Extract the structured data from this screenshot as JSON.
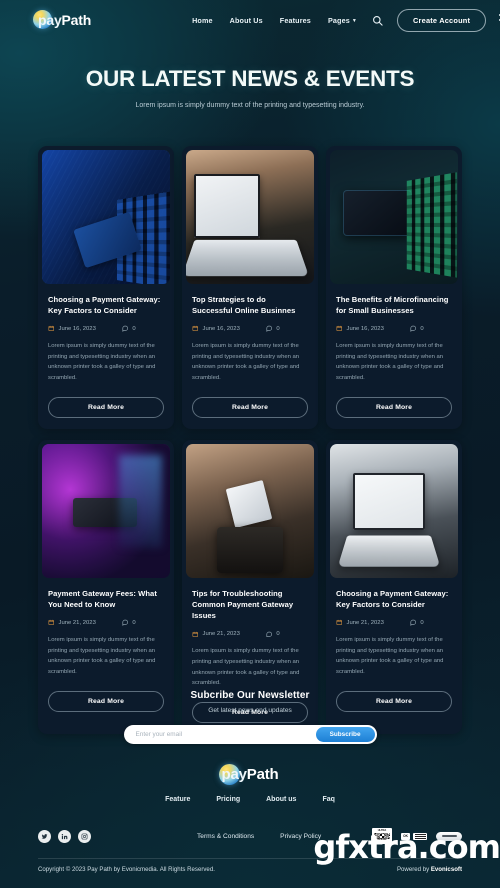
{
  "brand": {
    "name_part1": "pay",
    "name_part2": "Path"
  },
  "header": {
    "nav": [
      {
        "label": "Home",
        "has_caret": false
      },
      {
        "label": "About Us",
        "has_caret": false
      },
      {
        "label": "Features",
        "has_caret": false
      },
      {
        "label": "Pages",
        "has_caret": true
      }
    ],
    "search_icon": "search-icon",
    "cta_label": "Create Account",
    "menu_icon": "hamburger-menu-icon"
  },
  "hero": {
    "title": "OUR LATEST NEWS & EVENTS",
    "subtitle": "Lorem ipsum is simply dummy text of the printing and typesetting industry."
  },
  "posts": [
    {
      "title": "Choosing a Payment Gateway: Key Factors to Consider",
      "date": "June 16, 2023",
      "comments": "0",
      "excerpt": "Lorem ipsum is simply dummy text of the printing and typesetting industry when an unknown printer took a galley of type and scrambled.",
      "button": "Read More",
      "image": "payment-card-on-laptop-keyboard-blue"
    },
    {
      "title": "Top Strategies to do Successful Online Businnes",
      "date": "June 16, 2023",
      "comments": "0",
      "excerpt": "Lorem ipsum is simply dummy text of the printing and typesetting industry when an unknown printer took a galley of type and scrambled.",
      "button": "Read More",
      "image": "laptop-and-phone-with-stock-charts-on-desk"
    },
    {
      "title": "The Benefits of Microfinancing for Small Businesses",
      "date": "June 16, 2023",
      "comments": "0",
      "excerpt": "Lorem ipsum is simply dummy text of the printing and typesetting industry when an unknown printer took a galley of type and scrambled.",
      "button": "Read More",
      "image": "credit-card-beside-green-lit-keyboard"
    },
    {
      "title": "Payment Gateway Fees: What You Need to Know",
      "date": "June 21, 2023",
      "comments": "0",
      "excerpt": "Lorem ipsum is simply dummy text of the printing and typesetting industry when an unknown printer took a galley of type and scrambled.",
      "button": "Read More",
      "image": "hands-holding-card-reader-purple-light"
    },
    {
      "title": "Tips for Troubleshooting Common Payment Gateway Issues",
      "date": "June 21, 2023",
      "comments": "0",
      "excerpt": "Lorem ipsum is simply dummy text of the printing and typesetting industry when an unknown printer took a galley of type and scrambled.",
      "button": "Read More",
      "image": "hand-tapping-card-on-payment-terminal"
    },
    {
      "title": "Choosing a Payment Gateway: Key Factors to Consider",
      "date": "June 21, 2023",
      "comments": "0",
      "excerpt": "Lorem ipsum is simply dummy text of the printing and typesetting industry when an unknown printer took a galley of type and scrambled.",
      "button": "Read More",
      "image": "person-using-laptop-with-chart-on-screen"
    }
  ],
  "newsletter": {
    "title": "Subcribe Our Newsletter",
    "subtitle": "Get latest news and updates",
    "placeholder": "Enter your email",
    "input_value": "",
    "button": "Subscribe"
  },
  "footer": {
    "nav": [
      {
        "label": "Feature"
      },
      {
        "label": "Pricing"
      },
      {
        "label": "About us"
      },
      {
        "label": "Faq"
      }
    ],
    "socials": [
      {
        "name": "twitter-icon"
      },
      {
        "name": "linkedin-icon"
      },
      {
        "name": "instagram-icon"
      }
    ],
    "legal": [
      {
        "label": "Terms & Conditions"
      },
      {
        "label": "Privacy Policy"
      }
    ],
    "badges": [
      {
        "name": "ultra-clear-badge",
        "top": "ULTRA",
        "bottom": "CLEAR"
      },
      {
        "name": "secure-payment-badge",
        "mark": "OK"
      },
      {
        "name": "card-strip-badge"
      }
    ],
    "copyright": "Copyright © 2023 Pay Path by Evonicmedia. All Rights Reserved.",
    "powered_prefix": "Powered by ",
    "powered_brand": "Evonicsoft"
  },
  "watermark": "gfxtra.com",
  "colors": {
    "background_dark": "#0a1d2a",
    "background_teal": "#0d4552",
    "card_bg": "#0c1b2c",
    "accent_blue": "#1d7fd4",
    "date_icon": "#c98a3e",
    "muted_text": "#93a6b2"
  }
}
